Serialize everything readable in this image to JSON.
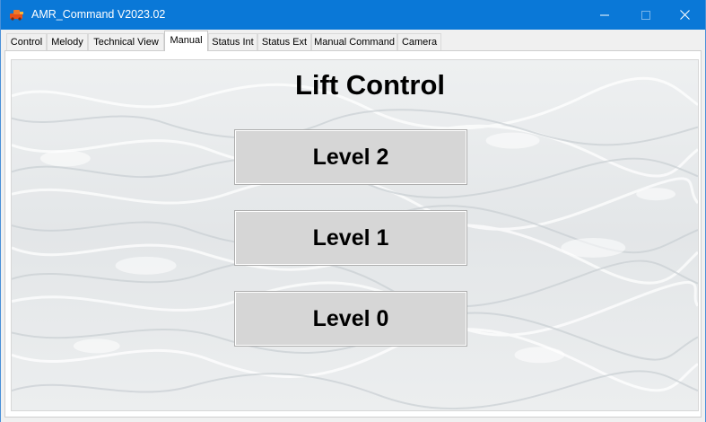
{
  "window": {
    "title": "AMR_Command V2023.02",
    "icon": "app-logo-icon",
    "controls": {
      "minimize": "minimize-icon",
      "maximize": "maximize-icon",
      "close": "close-icon"
    }
  },
  "tabs": [
    {
      "label": "Control"
    },
    {
      "label": "Melody"
    },
    {
      "label": "Technical View"
    },
    {
      "label": "Manual",
      "active": true
    },
    {
      "label": "Status Int"
    },
    {
      "label": "Status Ext"
    },
    {
      "label": "Manual Command"
    },
    {
      "label": "Camera"
    }
  ],
  "lift": {
    "heading": "Lift Control",
    "buttons": [
      {
        "label": "Level 2"
      },
      {
        "label": "Level 1"
      },
      {
        "label": "Level 0"
      }
    ]
  },
  "colors": {
    "titlebar": "#0a78d7",
    "button_face": "#d6d6d6"
  }
}
